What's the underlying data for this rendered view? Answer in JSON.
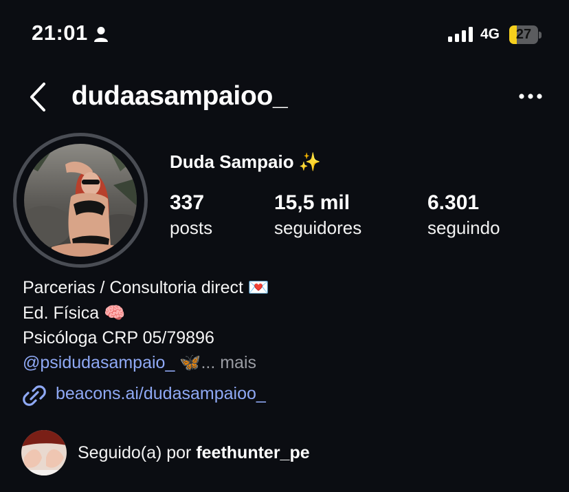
{
  "status_bar": {
    "time": "21:01",
    "network": "4G",
    "battery_level": 27,
    "battery_text": "27",
    "battery_color": "#f5cf1d"
  },
  "header": {
    "username": "dudaasampaioo_"
  },
  "profile": {
    "display_name": "Duda Sampaio ✨",
    "stats": [
      {
        "value": "337",
        "label": "posts"
      },
      {
        "value": "15,5 mil",
        "label": "seguidores"
      },
      {
        "value": "6.301",
        "label": "seguindo"
      }
    ],
    "bio_lines": [
      "Parcerias / Consultoria direct 💌",
      "Ed. Física 🧠",
      "Psicóloga CRP 05/79896"
    ],
    "mention": "@psidudasampaio_",
    "mention_suffix": " 🦋",
    "more_label": "... mais",
    "link": "beacons.ai/dudasampaioo_",
    "followed_by_prefix": "Seguido(a) por ",
    "followed_by_user": "feethunter_pe"
  },
  "colors": {
    "background": "#0b0d12",
    "link": "#8fa9f5",
    "avatar_ring": "#4a4d54"
  }
}
